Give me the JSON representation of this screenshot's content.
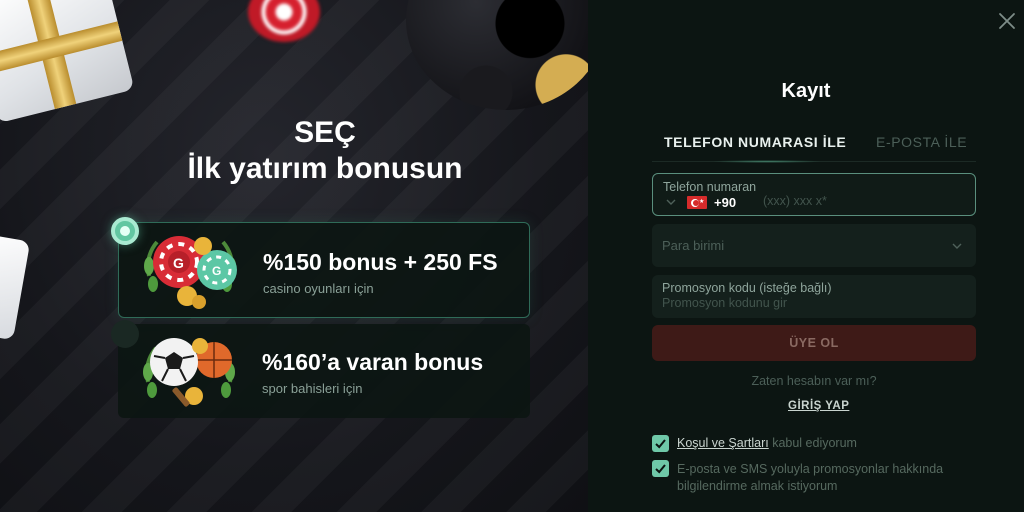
{
  "promo": {
    "title_line1": "SEÇ",
    "title_line2": "İlk yatırım bonusun",
    "offers": [
      {
        "title": "%150 bonus + 250 FS",
        "subtitle": "casino oyunları için",
        "selected": true
      },
      {
        "title": "%160’a varan bonus",
        "subtitle": "spor bahisleri için",
        "selected": false
      }
    ]
  },
  "register": {
    "title": "Kayıt",
    "tabs": [
      {
        "label": "TELEFON NUMARASI İLE",
        "active": true
      },
      {
        "label": "E-POSTA İLE",
        "active": false
      }
    ],
    "phone": {
      "label": "Telefon numaran",
      "country_code": "+90",
      "placeholder": "(xxx) xxx x*",
      "flag": "turkey-flag-icon"
    },
    "currency": {
      "placeholder": "Para birimi"
    },
    "promo_code": {
      "label": "Promosyon kodu (isteğe bağlı)",
      "placeholder": "Promosyon kodunu gir"
    },
    "submit_label": "ÜYE OL",
    "have_account": "Zaten hesabın var mı?",
    "login_label": "GİRİŞ YAP",
    "consents": [
      {
        "link_text": "Koşul ve Şartları",
        "text": " kabul ediyorum",
        "checked": true
      },
      {
        "text": "E-posta ve SMS yoluyla promosyonlar hakkında bilgilendirme almak istiyorum",
        "checked": true
      }
    ]
  },
  "colors": {
    "accent_green": "#62c6a1",
    "submit_bg": "#3e1a17",
    "panel_bg": "#0c1512"
  },
  "icons": [
    "close-icon",
    "chevron-down-icon",
    "turkey-flag-icon",
    "checkmark-icon",
    "casino-chips-icon",
    "sports-balls-icon"
  ]
}
